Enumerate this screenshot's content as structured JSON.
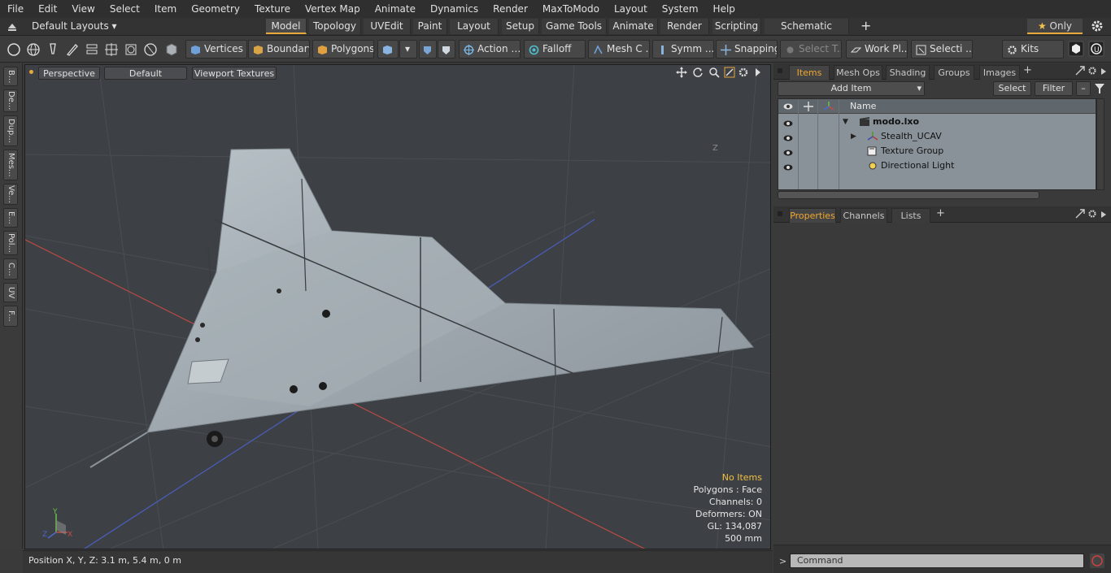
{
  "menu": [
    "File",
    "Edit",
    "View",
    "Select",
    "Item",
    "Geometry",
    "Texture",
    "Vertex Map",
    "Animate",
    "Dynamics",
    "Render",
    "MaxToModo",
    "Layout",
    "System",
    "Help"
  ],
  "layouts_label": "Default Layouts",
  "layout_tabs": [
    "Model",
    "Topology",
    "UVEdit",
    "Paint",
    "Layout",
    "Setup",
    "Game Tools",
    "Animate",
    "Render",
    "Scripting",
    "Schematic Fusion"
  ],
  "active_layout_tab": "Model",
  "only_label": "Only",
  "tools": {
    "vertices": "Vertices",
    "boundary": "Boundary",
    "polygons": "Polygons",
    "action": "Action",
    "falloff": "Falloff",
    "mesh": "Mesh C ...",
    "symm": "Symm ...",
    "snapping": "Snapping",
    "select_t": "Select T...",
    "work_pl": "Work Pl...",
    "selecti": "Selecti ...",
    "kits": "Kits"
  },
  "left_tabs": [
    "B...",
    "De...",
    "Dup...",
    "Mes...",
    "Ve...",
    "E...",
    "Pol...",
    "C...",
    "UV",
    "F..."
  ],
  "viewport": {
    "view_mode": "Perspective",
    "shading": "Default",
    "textures": "Viewport Textures",
    "info": {
      "selection": "No Items",
      "polygons": "Polygons : Face",
      "channels": "Channels: 0",
      "deformers": "Deformers: ON",
      "gl": "GL: 134,087",
      "scale": "500 mm"
    },
    "axis_z_label": "Z",
    "gizmo": {
      "x": "X",
      "y": "Y",
      "z": "Z"
    }
  },
  "status": {
    "position": "Position X, Y, Z:   3.1 m, 5.4 m, 0 m"
  },
  "panel_top": {
    "tabs": [
      "Items",
      "Mesh Ops",
      "Shading",
      "Groups",
      "Images"
    ],
    "active": "Items",
    "add_item": "Add Item",
    "select": "Select",
    "filter": "Filter",
    "name_header": "Name",
    "items": [
      {
        "name": "modo.lxo",
        "indent": 0,
        "bold": true
      },
      {
        "name": "Stealth_UCAV",
        "indent": 1,
        "bold": false
      },
      {
        "name": "Texture Group",
        "indent": 1,
        "bold": false
      },
      {
        "name": "Directional Light",
        "indent": 1,
        "bold": false
      }
    ]
  },
  "panel_bottom": {
    "tabs": [
      "Properties",
      "Channels",
      "Lists"
    ],
    "active": "Properties"
  },
  "command_placeholder": "Command",
  "colors": {
    "accent": "#e7a93c",
    "viewport_bg": "#3d4044",
    "item_list_bg": "#8a9299",
    "info_highlight": "#f0c040"
  }
}
